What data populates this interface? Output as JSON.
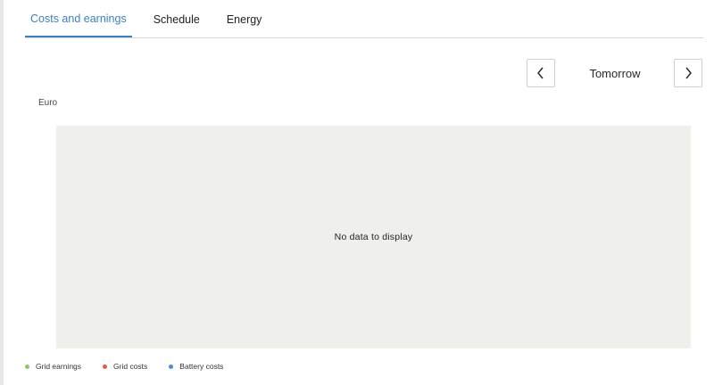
{
  "tabs": [
    {
      "label": "Costs and earnings",
      "active": true
    },
    {
      "label": "Schedule",
      "active": false
    },
    {
      "label": "Energy",
      "active": false
    }
  ],
  "date_nav": {
    "label": "Tomorrow",
    "prev_icon": "chevron-left-icon",
    "next_icon": "chevron-right-icon"
  },
  "chart": {
    "unit_label": "Euro",
    "empty_message": "No data to display"
  },
  "legend": [
    {
      "label": "Grid earnings",
      "color": "#8cc665"
    },
    {
      "label": "Grid costs",
      "color": "#e8574f"
    },
    {
      "label": "Battery costs",
      "color": "#4a8fd6"
    }
  ],
  "colors": {
    "accent": "#3b7fc4",
    "plot_background": "#efefec"
  }
}
